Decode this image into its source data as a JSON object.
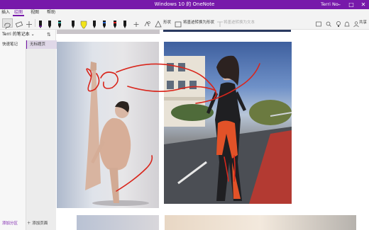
{
  "window": {
    "title": "Windows 10 的 OneNote",
    "user": "Terri No",
    "controls": [
      "minimize",
      "maximize",
      "close"
    ]
  },
  "menu": {
    "items": [
      {
        "label": "插入",
        "active": false
      },
      {
        "label": "绘图",
        "active": true
      },
      {
        "label": "视图",
        "active": false
      },
      {
        "label": "帮助",
        "active": false
      }
    ]
  },
  "toolbar": {
    "tools": [
      "lasso-select",
      "eraser",
      "add-space",
      "pen-black",
      "pen-black",
      "pen-teal",
      "highlighter-yellow",
      "pen-black",
      "pen-blue",
      "pen-red",
      "pen-black",
      "pen-black",
      "add-pen",
      "ink-to-shape"
    ],
    "shape_label": "形状",
    "ink_to_shape_label": "将墨迹转换为形状",
    "ink_to_text_label": "将墨迹转换为文本",
    "pen_colors": [
      "#1a1a1a",
      "#1a1a1a",
      "#2aa79b",
      "#f2e41b",
      "#1a1a1a",
      "#2563c9",
      "#e02020",
      "#1a1a1a",
      "#1a1a1a"
    ],
    "share_label": "共享"
  },
  "sidebar": {
    "notebook_title": "Terri 的笔记本",
    "section": "快速笔记",
    "page": "无标题页",
    "add_section": "添加分区",
    "add_page": "添加页面"
  },
  "colors": {
    "accent": "#7719aa",
    "ink": "#d9261c",
    "accent_tab": "#7719aa"
  }
}
